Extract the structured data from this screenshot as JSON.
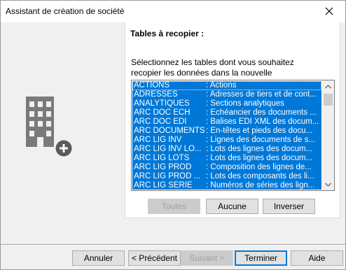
{
  "window": {
    "title": "Assistant de création de société"
  },
  "panel": {
    "section_title": "Tables à recopier :",
    "instructions_line1": "Sélectionnez les tables dont vous souhaitez",
    "instructions_line2": "recopier les données dans la nouvelle"
  },
  "tables": [
    {
      "code": "ACTIONS",
      "desc": ": Actions"
    },
    {
      "code": "ADRESSES",
      "desc": ": Adresses de tiers et de cont..."
    },
    {
      "code": "ANALYTIQUES",
      "desc": ": Sections analytiques"
    },
    {
      "code": "ARC DOC ECH",
      "desc": ": Echéancier des documents ..."
    },
    {
      "code": "ARC DOC EDI",
      "desc": ": Balises EDI XML des docum..."
    },
    {
      "code": "ARC DOCUMENTS",
      "desc": ": En-têtes et pieds des docu..."
    },
    {
      "code": "ARC LIG INV",
      "desc": ": Lignes des documents de s..."
    },
    {
      "code": "ARC LIG INV LO...",
      "desc": ": Lots des lignes des docum..."
    },
    {
      "code": "ARC LIG LOTS",
      "desc": ": Lots des lignes des docum..."
    },
    {
      "code": "ARC LIG PROD",
      "desc": ": Composition des lignes de..."
    },
    {
      "code": "ARC LIG PROD ...",
      "desc": ": Lots des composants des li..."
    },
    {
      "code": "ARC LIG SERIE",
      "desc": ": Numéros de séries des lign..."
    }
  ],
  "list_buttons": {
    "all": "Toutes",
    "none": "Aucune",
    "invert": "Inverser"
  },
  "footer_buttons": {
    "cancel": "Annuler",
    "previous": "< Précédent",
    "next": "Suivant >",
    "finish": "Terminer",
    "help": "Aide"
  },
  "colors": {
    "selection": "#0078d7",
    "icon": "#7a7a7a"
  }
}
